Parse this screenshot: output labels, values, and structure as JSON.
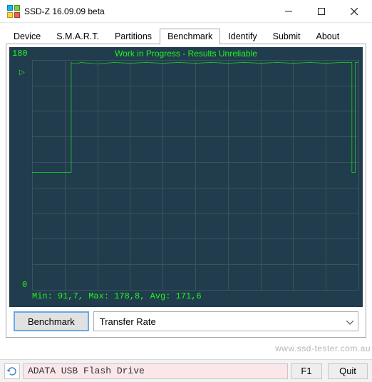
{
  "window": {
    "title": "SSD-Z 16.09.09 beta"
  },
  "tabs": [
    "Device",
    "S.M.A.R.T.",
    "Partitions",
    "Benchmark",
    "Identify",
    "Submit",
    "About"
  ],
  "active_tab": 3,
  "chart_data": {
    "type": "line",
    "title": "Work in Progress - Results Unreliable",
    "ylabel": "",
    "xlabel": "",
    "ylim": [
      0,
      180
    ],
    "xlim": [
      0,
      100
    ],
    "ytick_labels": {
      "top": "180",
      "bottom": "0"
    },
    "stats": {
      "min": 91.7,
      "max": 178.8,
      "avg": 171.6
    },
    "stats_line": "Min: 91,7, Max: 178,8, Avg: 171,6",
    "cursor_marker": "▷",
    "series": [
      {
        "name": "Transfer Rate",
        "x": [
          0,
          1,
          2,
          3,
          4,
          5,
          6,
          7,
          8,
          9,
          10,
          11,
          12,
          98,
          99,
          100
        ],
        "values": [
          92,
          92,
          92,
          92,
          92,
          92,
          92,
          92,
          92,
          92,
          92,
          92,
          178,
          178,
          92,
          178
        ]
      }
    ]
  },
  "controls": {
    "benchmark_label": "Benchmark",
    "metric_selected": "Transfer Rate"
  },
  "statusbar": {
    "device": "ADATA USB Flash Drive",
    "f1_label": "F1",
    "quit_label": "Quit"
  },
  "watermark": "www.ssd-tester.com.au",
  "colors": {
    "bg": "#213c4c",
    "fg": "#1cf91c",
    "grid": "#3a5361"
  }
}
